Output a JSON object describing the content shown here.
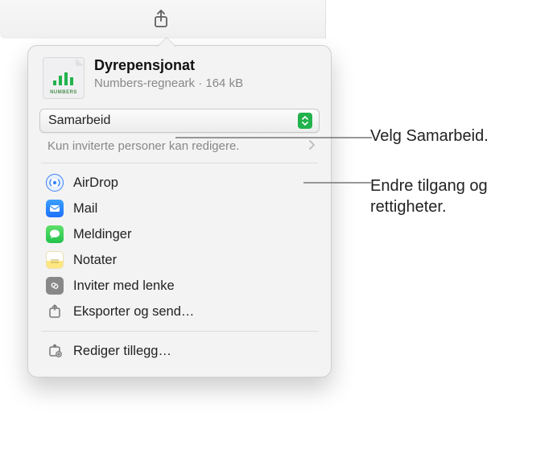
{
  "toolbar": {
    "share_icon_name": "share-icon"
  },
  "file": {
    "title": "Dyrepensjonat",
    "subtitle": "Numbers-regneark · 164 kB",
    "icon_label": "NUMBERS"
  },
  "collab": {
    "mode_label": "Samarbeid",
    "permissions_text": "Kun inviterte personer kan redigere."
  },
  "share_targets": [
    {
      "id": "airdrop",
      "label": "AirDrop",
      "icon": "airdrop-icon",
      "iconClass": "mi-airdrop"
    },
    {
      "id": "mail",
      "label": "Mail",
      "icon": "mail-icon",
      "iconClass": "mi-mail"
    },
    {
      "id": "messages",
      "label": "Meldinger",
      "icon": "messages-icon",
      "iconClass": "mi-msg"
    },
    {
      "id": "notes",
      "label": "Notater",
      "icon": "notes-icon",
      "iconClass": "mi-notes"
    },
    {
      "id": "invite-link",
      "label": "Inviter med lenke",
      "icon": "link-icon",
      "iconClass": "mi-link"
    },
    {
      "id": "export-send",
      "label": "Eksporter og send…",
      "icon": "export-icon",
      "iconClass": "mi-gray"
    }
  ],
  "footer": {
    "edit_extensions_label": "Rediger tillegg…"
  },
  "callouts": {
    "c1": "Velg Samarbeid.",
    "c2": "Endre tilgang og rettigheter."
  }
}
